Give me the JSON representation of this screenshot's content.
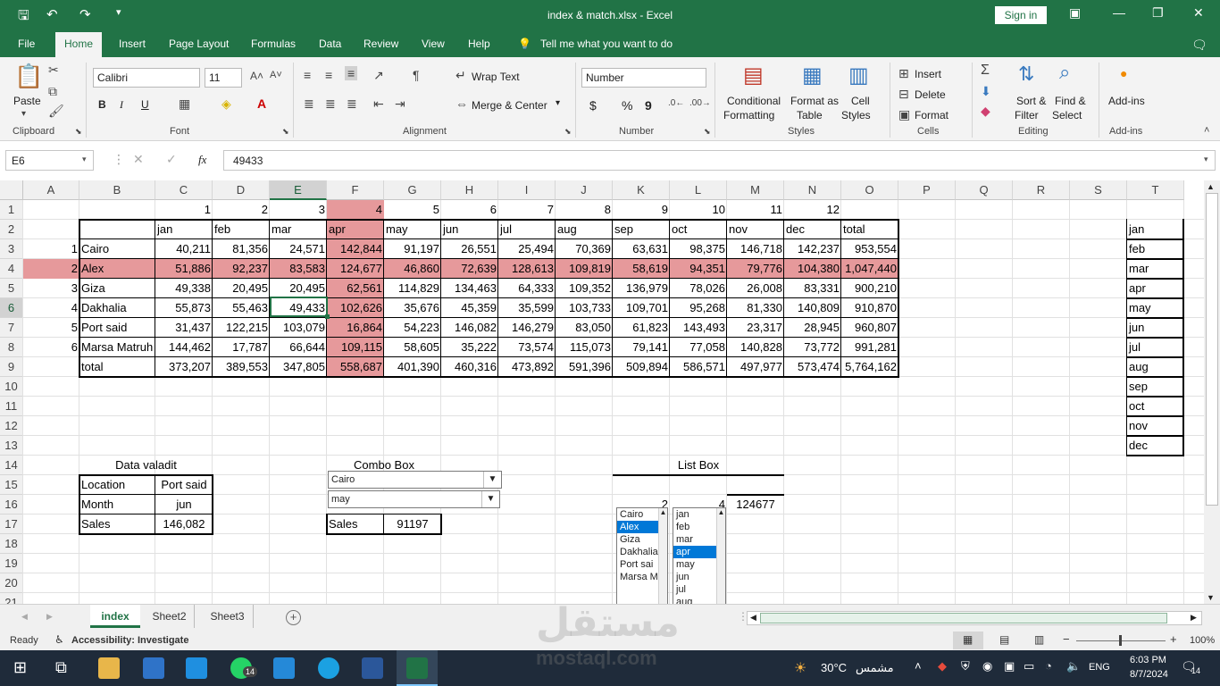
{
  "window": {
    "title": "index & match.xlsx  -  Excel",
    "sign_in": "Sign in"
  },
  "menu": {
    "tabs": [
      "File",
      "Home",
      "Insert",
      "Page Layout",
      "Formulas",
      "Data",
      "Review",
      "View",
      "Help"
    ],
    "active": "Home",
    "tell_me": "Tell me what you want to do"
  },
  "ribbon": {
    "clipboard": {
      "paste": "Paste",
      "label": "Clipboard"
    },
    "font": {
      "name": "Calibri",
      "size": "11",
      "label": "Font",
      "bold": "B",
      "italic": "I",
      "underline": "U"
    },
    "alignment": {
      "wrap_text": "Wrap Text",
      "merge_center": "Merge & Center",
      "label": "Alignment"
    },
    "number": {
      "format": "Number",
      "label": "Number",
      "currency": "$",
      "percent": "%",
      "comma": "9"
    },
    "styles": {
      "conditional": "Conditional",
      "formatting": "Formatting",
      "format_as": "Format as",
      "table": "Table",
      "cell": "Cell",
      "styles_btn": "Styles",
      "label": "Styles"
    },
    "cells": {
      "insert": "Insert",
      "delete": "Delete",
      "format": "Format",
      "label": "Cells"
    },
    "editing": {
      "sort": "Sort &",
      "filter": "Filter",
      "find": "Find &",
      "select": "Select",
      "label": "Editing"
    },
    "addins": {
      "btn": "Add-ins",
      "label": "Add-ins"
    }
  },
  "formula_bar": {
    "name_box": "E6",
    "fx": "fx",
    "formula": "49433"
  },
  "columns": [
    "A",
    "B",
    "C",
    "D",
    "E",
    "F",
    "G",
    "H",
    "I",
    "J",
    "K",
    "L",
    "M",
    "N",
    "O",
    "P",
    "Q",
    "R",
    "S",
    "T"
  ],
  "rows": [
    "1",
    "2",
    "3",
    "4",
    "5",
    "6",
    "7",
    "8",
    "9",
    "10",
    "11",
    "12",
    "13",
    "14",
    "15",
    "16",
    "17",
    "18",
    "19",
    "20",
    "21"
  ],
  "row1_numbers": [
    "1",
    "2",
    "3",
    "4",
    "5",
    "6",
    "7",
    "8",
    "9",
    "10",
    "11",
    "12"
  ],
  "table": {
    "headers": [
      "jan",
      "feb",
      "mar",
      "apr",
      "may",
      "jun",
      "jul",
      "aug",
      "sep",
      "oct",
      "nov",
      "dec",
      "total"
    ],
    "index": [
      "1",
      "2",
      "3",
      "4",
      "5",
      "6"
    ],
    "rows": [
      {
        "name": "Cairo",
        "values": [
          "40,211",
          "81,356",
          "24,571",
          "142,844",
          "91,197",
          "26,551",
          "25,494",
          "70,369",
          "63,631",
          "98,375",
          "146,718",
          "142,237",
          "953,554"
        ]
      },
      {
        "name": "Alex",
        "values": [
          "51,886",
          "92,237",
          "83,583",
          "124,677",
          "46,860",
          "72,639",
          "128,613",
          "109,819",
          "58,619",
          "94,351",
          "79,776",
          "104,380",
          "1,047,440"
        ]
      },
      {
        "name": "Giza",
        "values": [
          "49,338",
          "20,495",
          "20,495",
          "62,561",
          "114,829",
          "134,463",
          "64,333",
          "109,352",
          "136,979",
          "78,026",
          "26,008",
          "83,331",
          "900,210"
        ]
      },
      {
        "name": "Dakhalia",
        "values": [
          "55,873",
          "55,463",
          "49,433",
          "102,626",
          "35,676",
          "45,359",
          "35,599",
          "103,733",
          "109,701",
          "95,268",
          "81,330",
          "140,809",
          "910,870"
        ]
      },
      {
        "name": "Port said",
        "values": [
          "31,437",
          "122,215",
          "103,079",
          "16,864",
          "54,223",
          "146,082",
          "146,279",
          "83,050",
          "61,823",
          "143,493",
          "23,317",
          "28,945",
          "960,807"
        ]
      },
      {
        "name": "Marsa Matruh",
        "values": [
          "144,462",
          "17,787",
          "66,644",
          "109,115",
          "58,605",
          "35,222",
          "73,574",
          "115,073",
          "79,141",
          "77,058",
          "140,828",
          "73,772",
          "991,281"
        ]
      },
      {
        "name": "total",
        "values": [
          "373,207",
          "389,553",
          "347,805",
          "558,687",
          "401,390",
          "460,316",
          "473,892",
          "591,396",
          "509,894",
          "586,571",
          "497,977",
          "573,474",
          "5,764,162"
        ]
      }
    ]
  },
  "months_list": [
    "jan",
    "feb",
    "mar",
    "apr",
    "may",
    "jun",
    "jul",
    "aug",
    "sep",
    "oct",
    "nov",
    "dec"
  ],
  "data_validation": {
    "title": "Data valadit",
    "location_label": "Location",
    "location_value": "Port said",
    "month_label": "Month",
    "month_value": "jun",
    "sales_label": "Sales",
    "sales_value": "146,082"
  },
  "combo_box": {
    "title": "Combo Box",
    "city": "Cairo",
    "month": "may",
    "sales_label": "Sales",
    "sales_value": "91197"
  },
  "list_box": {
    "title": "List Box",
    "city_index": "2",
    "month_index": "4",
    "result": "124677",
    "cities": [
      "Cairo",
      "Alex",
      "Giza",
      "Dakhalia",
      "Port sai",
      "Marsa M"
    ],
    "selected_city": "Alex",
    "months": [
      "jan",
      "feb",
      "mar",
      "apr",
      "may",
      "jun",
      "jul",
      "aug"
    ],
    "selected_month": "apr"
  },
  "sheet_tabs": [
    "index",
    "Sheet2",
    "Sheet3"
  ],
  "active_sheet": "index",
  "status": {
    "ready": "Ready",
    "accessibility": "Accessibility: Investigate",
    "zoom": "100%"
  },
  "taskbar": {
    "weather": "30°C",
    "weather_text": "مشمس",
    "lang": "ENG",
    "time": "6:03 PM",
    "date": "8/7/2024",
    "notifications": "14",
    "whatsapp_badge": "14"
  },
  "watermark": {
    "arabic": "مستقل",
    "latin": "mostaql.com"
  },
  "colors": {
    "excel_green": "#217346",
    "highlight": "#e6999b",
    "selection_blue": "#0078d7"
  }
}
